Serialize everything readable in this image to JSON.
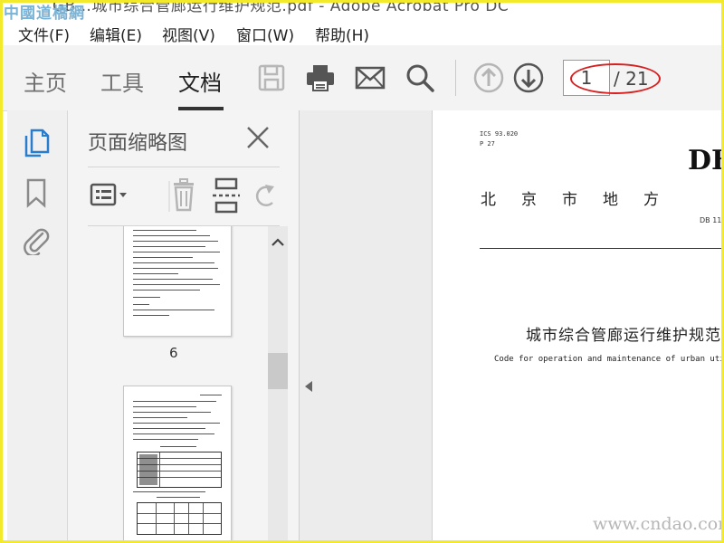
{
  "window": {
    "title": "GB…城市综合管廊运行维护规范.pdf - Adobe Acrobat Pro DC",
    "watermark_top": "中國道橋網",
    "watermark_bottom": "www.cndao.com"
  },
  "menu": {
    "file": "文件(F)",
    "edit": "编辑(E)",
    "view": "视图(V)",
    "window": "窗口(W)",
    "help": "帮助(H)"
  },
  "toolbar": {
    "tabs": [
      "主页",
      "工具",
      "文档"
    ],
    "active_tab": "文档",
    "current_page": "1",
    "total_pages": "/ 21"
  },
  "panel": {
    "title": "页面缩略图",
    "thumb_label": "6"
  },
  "document": {
    "ics": "ICS  93.020",
    "p": "P 27",
    "db": "DB",
    "region": "北京市地方",
    "db_number": "DB 11",
    "title_cn": "城市综合管廊运行维护规范",
    "title_en": "Code for operation and maintenance of urban utility"
  },
  "colors": {
    "frame": "#f2ea2a",
    "annotation": "#d82020",
    "accent": "#2a7dcc"
  }
}
